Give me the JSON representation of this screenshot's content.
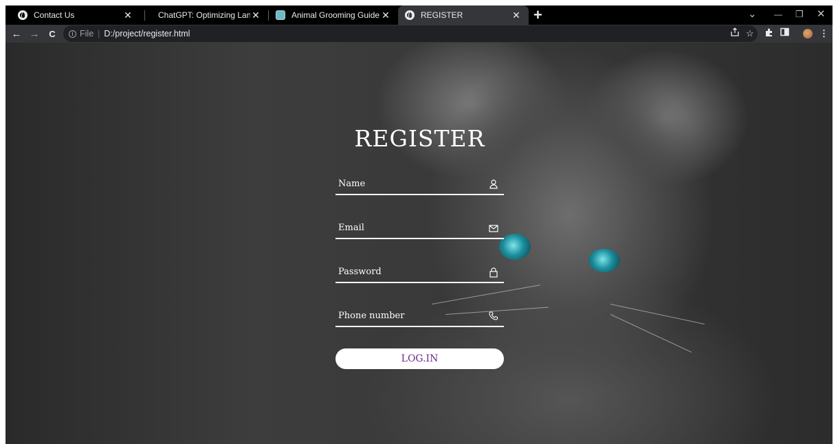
{
  "browser": {
    "tabs": [
      {
        "title": "Contact Us",
        "icon": "globe-icon",
        "active": false
      },
      {
        "title": "ChatGPT: Optimizing Language M",
        "icon": "none",
        "active": false
      },
      {
        "title": "Animal Grooming Guide",
        "icon": "teal-favicon-icon",
        "active": false
      },
      {
        "title": "REGISTER",
        "icon": "globe-icon",
        "active": true
      }
    ],
    "close_glyph": "✕",
    "new_tab_glyph": "+",
    "window_controls": {
      "menu": "⌄",
      "minimize": "—",
      "restore": "❐",
      "close": "✕"
    },
    "nav": {
      "back": "←",
      "forward": "→",
      "reload": "C"
    },
    "address": {
      "scheme_label": "File",
      "separator": "|",
      "url": "D:/project/register.html"
    }
  },
  "form": {
    "title": "REGISTER",
    "fields": [
      {
        "label": "Name",
        "icon": "person-icon"
      },
      {
        "label": "Email",
        "icon": "envelope-icon"
      },
      {
        "label": "Password",
        "icon": "lock-icon"
      },
      {
        "label": "Phone number",
        "icon": "phone-icon"
      }
    ],
    "submit_label": "LOG.IN"
  },
  "colors": {
    "tab_bar": "#000000",
    "toolbar": "#35363a",
    "button_text": "#6a2a8a",
    "eye_teal": "#1b8e9c"
  }
}
